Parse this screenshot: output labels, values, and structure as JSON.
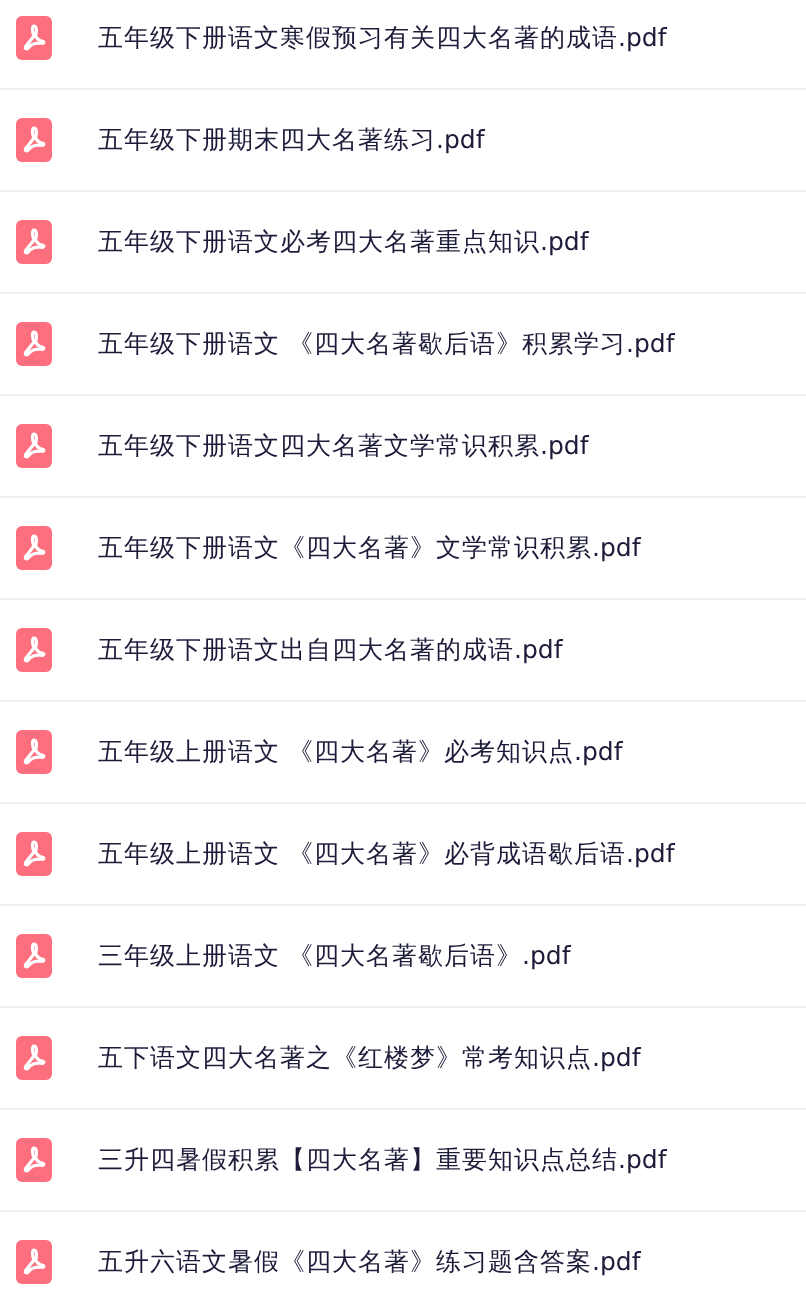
{
  "files": [
    {
      "name": "五年级下册语文寒假预习有关四大名著的成语.pdf",
      "kind": "pdf"
    },
    {
      "name": "五年级下册期末四大名著练习.pdf",
      "kind": "pdf"
    },
    {
      "name": "五年级下册语文必考四大名著重点知识.pdf",
      "kind": "pdf"
    },
    {
      "name": "五年级下册语文 《四大名著歇后语》积累学习.pdf",
      "kind": "pdf"
    },
    {
      "name": "五年级下册语文四大名著文学常识积累.pdf",
      "kind": "pdf"
    },
    {
      "name": "五年级下册语文《四大名著》文学常识积累.pdf",
      "kind": "pdf"
    },
    {
      "name": "五年级下册语文出自四大名著的成语.pdf",
      "kind": "pdf"
    },
    {
      "name": "五年级上册语文 《四大名著》必考知识点.pdf",
      "kind": "pdf"
    },
    {
      "name": "五年级上册语文 《四大名著》必背成语歇后语.pdf",
      "kind": "pdf"
    },
    {
      "name": "三年级上册语文 《四大名著歇后语》.pdf",
      "kind": "pdf"
    },
    {
      "name": "五下语文四大名著之《红楼梦》常考知识点.pdf",
      "kind": "pdf"
    },
    {
      "name": "三升四暑假积累【四大名著】重要知识点总结.pdf",
      "kind": "pdf"
    },
    {
      "name": "五升六语文暑假《四大名著》练习题含答案.pdf",
      "kind": "pdf"
    }
  ]
}
